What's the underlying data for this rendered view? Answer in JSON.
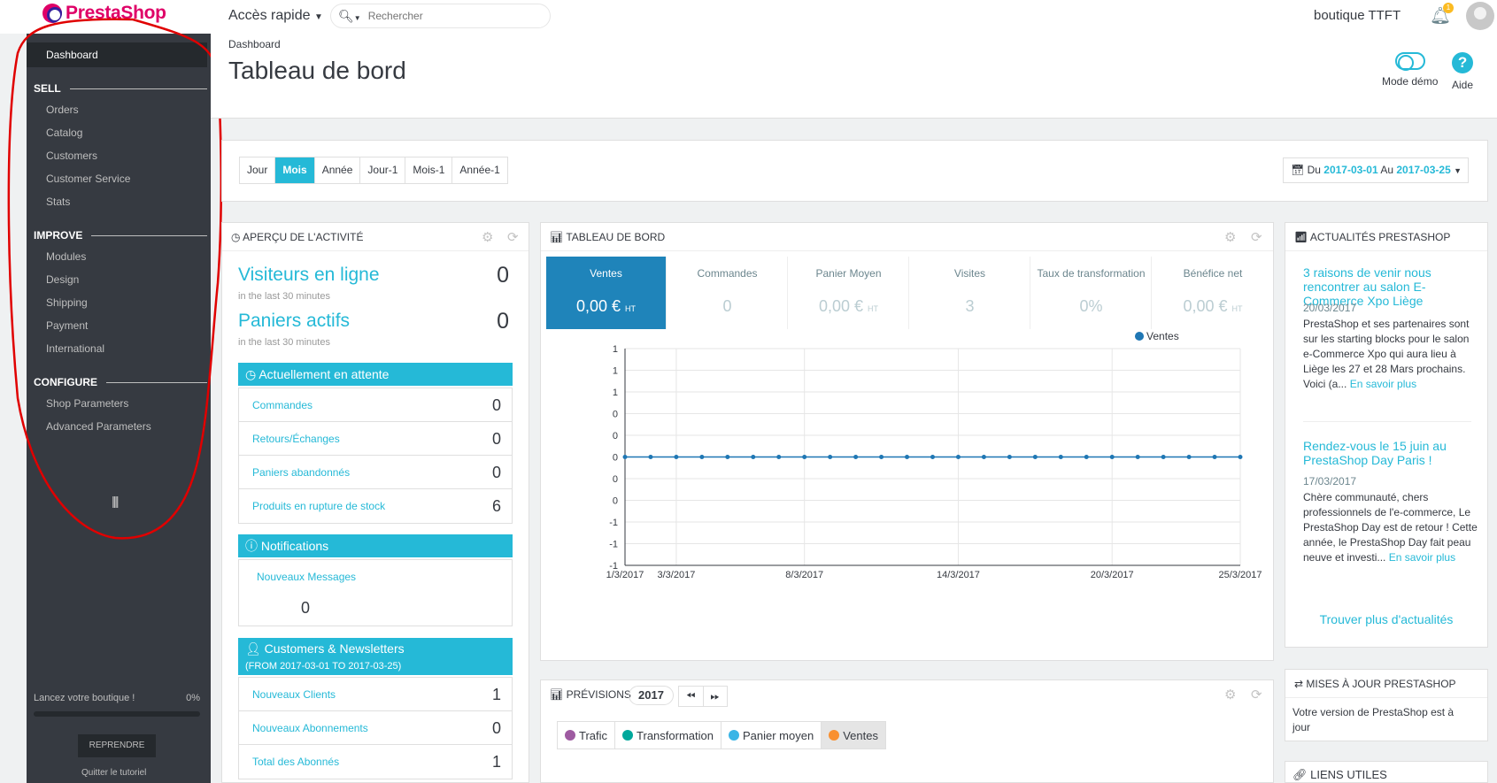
{
  "topbar": {
    "logo_text": "PrestaShop",
    "quick_access": "Accès rapide",
    "search_placeholder": "Rechercher",
    "shop_name": "boutique TTFT",
    "notifications_count": "1"
  },
  "sidebar": {
    "dashboard": "Dashboard",
    "sections": [
      {
        "title": "SELL",
        "items": [
          "Orders",
          "Catalog",
          "Customers",
          "Customer Service",
          "Stats"
        ]
      },
      {
        "title": "IMPROVE",
        "items": [
          "Modules",
          "Design",
          "Shipping",
          "Payment",
          "International"
        ]
      },
      {
        "title": "CONFIGURE",
        "items": [
          "Shop Parameters",
          "Advanced Parameters"
        ]
      }
    ],
    "tutorial_label": "Lancez votre boutique !",
    "tutorial_progress": "0%",
    "resume_label": "REPRENDRE",
    "quit_label": "Quitter le tutoriel"
  },
  "header": {
    "breadcrumb": "Dashboard",
    "title": "Tableau de bord",
    "demo_label": "Mode démo",
    "help_label": "Aide"
  },
  "filters": {
    "periods": [
      "Jour",
      "Mois",
      "Année",
      "Jour-1",
      "Mois-1",
      "Année-1"
    ],
    "active_period": "Mois",
    "date_prefix": "Du",
    "date_from": "2017-03-01",
    "date_mid": "Au",
    "date_to": "2017-03-25"
  },
  "activity": {
    "title": "APERÇU DE L'ACTIVITÉ",
    "online_label": "Visiteurs en ligne",
    "online_value": "0",
    "online_sub": "in the last 30 minutes",
    "carts_label": "Paniers actifs",
    "carts_value": "0",
    "carts_sub": "in the last 30 minutes",
    "pending_title": "Actuellement en attente",
    "pending": [
      {
        "label": "Commandes",
        "value": "0"
      },
      {
        "label": "Retours/Échanges",
        "value": "0"
      },
      {
        "label": "Paniers abandonnés",
        "value": "0"
      },
      {
        "label": "Produits en rupture de stock",
        "value": "6"
      }
    ],
    "notif_title": "Notifications",
    "notif_label": "Nouveaux Messages",
    "notif_value": "0",
    "cust_title": "Customers & Newsletters",
    "cust_sub": "(FROM 2017-03-01 TO 2017-03-25)",
    "cust": [
      {
        "label": "Nouveaux Clients",
        "value": "1"
      },
      {
        "label": "Nouveaux Abonnements",
        "value": "0"
      },
      {
        "label": "Total des Abonnés",
        "value": "1"
      }
    ]
  },
  "dashboard_panel": {
    "title": "TABLEAU DE BORD",
    "kpis": [
      {
        "label": "Ventes",
        "value": "0,00 €",
        "unit": "HT"
      },
      {
        "label": "Commandes",
        "value": "0",
        "unit": ""
      },
      {
        "label": "Panier Moyen",
        "value": "0,00 €",
        "unit": "HT"
      },
      {
        "label": "Visites",
        "value": "3",
        "unit": ""
      },
      {
        "label": "Taux de transformation",
        "value": "0%",
        "unit": ""
      },
      {
        "label": "Bénéfice net",
        "value": "0,00 €",
        "unit": "HT"
      }
    ],
    "colors": {
      "active_kpi": "#1f84ba",
      "series": "#1f77b4"
    }
  },
  "chart_data": {
    "type": "line",
    "series": [
      {
        "name": "Ventes",
        "values": [
          0,
          0,
          0,
          0,
          0,
          0,
          0,
          0,
          0,
          0,
          0,
          0,
          0,
          0,
          0,
          0,
          0,
          0,
          0,
          0,
          0,
          0,
          0,
          0,
          0
        ]
      }
    ],
    "x": [
      "1/3/2017",
      "2/3/2017",
      "3/3/2017",
      "4/3/2017",
      "5/3/2017",
      "6/3/2017",
      "7/3/2017",
      "8/3/2017",
      "9/3/2017",
      "10/3/2017",
      "11/3/2017",
      "12/3/2017",
      "13/3/2017",
      "14/3/2017",
      "15/3/2017",
      "16/3/2017",
      "17/3/2017",
      "18/3/2017",
      "19/3/2017",
      "20/3/2017",
      "21/3/2017",
      "22/3/2017",
      "23/3/2017",
      "24/3/2017",
      "25/3/2017"
    ],
    "x_tick_labels": [
      "1/3/2017",
      "3/3/2017",
      "8/3/2017",
      "14/3/2017",
      "20/3/2017",
      "25/3/2017"
    ],
    "y_tick_labels": [
      "1",
      "1",
      "1",
      "0",
      "0",
      "0",
      "0",
      "0",
      "-1",
      "-1",
      "-1"
    ],
    "ylim": [
      -1,
      1
    ],
    "legend_position": "top-right",
    "grid": true
  },
  "news": {
    "title": "ACTUALITÉS PRESTASHOP",
    "items": [
      {
        "title": "3 raisons de venir nous rencontrer au salon E-Commerce Xpo Liège",
        "date": "20/03/2017",
        "body": "PrestaShop et ses partenaires sont sur les starting blocks pour le salon e-Commerce Xpo qui aura lieu à Liège les 27 et 28 Mars prochains. Voici (a...",
        "more": "En savoir plus"
      },
      {
        "title": "Rendez-vous le 15 juin au PrestaShop Day Paris !",
        "date": "17/03/2017",
        "body": "Chère communauté, chers professionnels de l'e-commerce, Le PrestaShop Day est de retour ! Cette année, le PrestaShop Day fait peau neuve et investi...",
        "more": "En savoir plus"
      }
    ],
    "more_news": "Trouver plus d'actualités"
  },
  "forecast": {
    "title": "PRÉVISIONS",
    "year": "2017",
    "chips": [
      {
        "label": "Trafic",
        "color": "#9e5ba1"
      },
      {
        "label": "Transformation",
        "color": "#00a89c"
      },
      {
        "label": "Panier moyen",
        "color": "#3ab5e6"
      },
      {
        "label": "Ventes",
        "color": "#f99031"
      }
    ]
  },
  "updates": {
    "title": "MISES À JOUR PRESTASHOP",
    "text": "Votre version de PrestaShop est à jour"
  },
  "links": {
    "title": "LIENS UTILES"
  }
}
